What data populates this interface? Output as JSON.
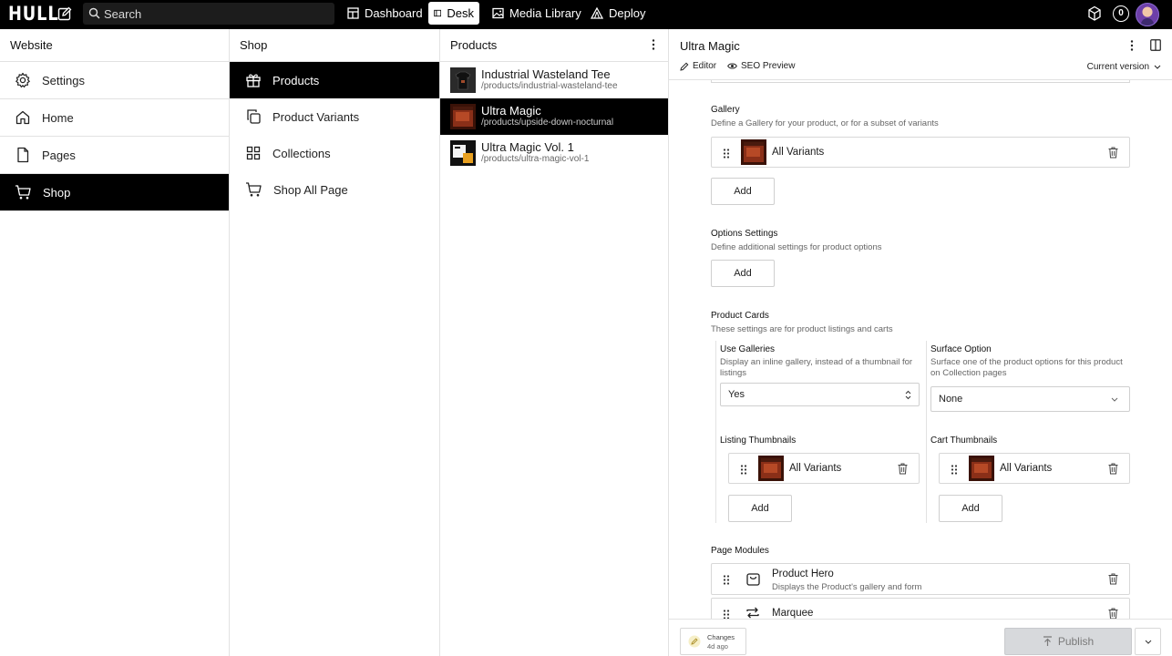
{
  "app": {
    "logo": "HULL"
  },
  "topbar": {
    "search_placeholder": "Search",
    "nav": [
      {
        "label": "Dashboard",
        "icon": "dashboard-icon"
      },
      {
        "label": "Desk",
        "icon": "desk-icon",
        "active": true
      },
      {
        "label": "Media Library",
        "icon": "image-icon"
      },
      {
        "label": "Deploy",
        "icon": "deploy-icon"
      }
    ],
    "notification_count": "0"
  },
  "website_pane": {
    "title": "Website",
    "items": [
      {
        "label": "Settings",
        "icon": "gear-icon"
      },
      {
        "label": "Home",
        "icon": "home-icon"
      },
      {
        "label": "Pages",
        "icon": "document-icon"
      },
      {
        "label": "Shop",
        "icon": "cart-icon",
        "active": true
      }
    ]
  },
  "shop_pane": {
    "title": "Shop",
    "items": [
      {
        "label": "Products",
        "icon": "gift-icon",
        "active": true
      },
      {
        "label": "Product Variants",
        "icon": "copy-icon"
      },
      {
        "label": "Collections",
        "icon": "grid-icon"
      },
      {
        "label": "Shop All Page",
        "icon": "cart-icon"
      }
    ]
  },
  "products_pane": {
    "title": "Products",
    "items": [
      {
        "title": "Industrial Wasteland Tee",
        "slug": "/products/industrial-wasteland-tee"
      },
      {
        "title": "Ultra Magic",
        "slug": "/products/upside-down-nocturnal",
        "active": true
      },
      {
        "title": "Ultra Magic Vol. 1",
        "slug": "/products/ultra-magic-vol-1"
      }
    ]
  },
  "editor": {
    "title": "Ultra Magic",
    "tabs": {
      "editor": "Editor",
      "seo": "SEO Preview"
    },
    "version": "Current version",
    "gallery": {
      "title": "Gallery",
      "desc": "Define a Gallery for your product, or for a subset of variants",
      "item": "All Variants",
      "add": "Add"
    },
    "options_settings": {
      "title": "Options Settings",
      "desc": "Define additional settings for product options",
      "add": "Add"
    },
    "product_cards": {
      "title": "Product Cards",
      "desc": "These settings are for product listings and carts",
      "use_galleries": {
        "title": "Use Galleries",
        "desc": "Display an inline gallery, instead of a thumbnail for listings",
        "value": "Yes"
      },
      "surface_option": {
        "title": "Surface Option",
        "desc": "Surface one of the product options for this product on Collection pages",
        "value": "None"
      },
      "listing_thumbnails": {
        "title": "Listing Thumbnails",
        "item": "All Variants",
        "add": "Add"
      },
      "cart_thumbnails": {
        "title": "Cart Thumbnails",
        "item": "All Variants",
        "add": "Add"
      }
    },
    "page_modules": {
      "title": "Page Modules",
      "items": [
        {
          "title": "Product Hero",
          "desc": "Displays the Product's gallery and form",
          "icon": "bag-icon"
        },
        {
          "title": "Marquee",
          "desc": "",
          "icon": "repeat-icon"
        }
      ]
    },
    "footer": {
      "changes_label": "Changes",
      "changes_time": "4d ago",
      "publish": "Publish"
    }
  }
}
